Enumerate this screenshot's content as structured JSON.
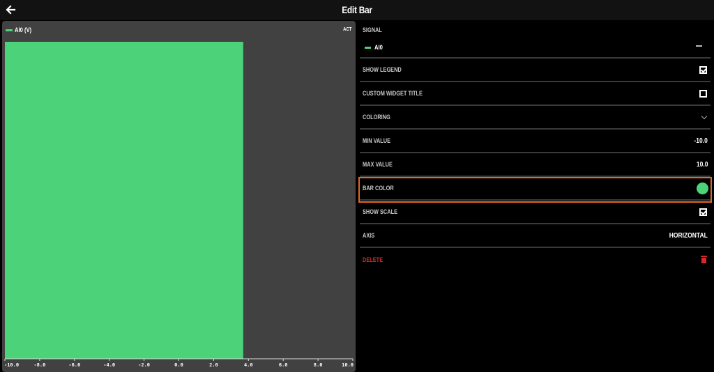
{
  "header": {
    "title": "Edit Bar",
    "back_icon": "arrow-left-icon"
  },
  "chart": {
    "legend_label": "AI0 (V)",
    "act_label": "ACT",
    "bar_color": "#4cd37a",
    "background": "#414141"
  },
  "chart_data": {
    "type": "bar",
    "orientation": "horizontal",
    "series": [
      {
        "name": "AI0 (V)",
        "values": [
          3.7
        ]
      }
    ],
    "xlim": [
      -10.0,
      10.0
    ],
    "xticks": [
      "-10.0",
      "-8.0",
      "-6.0",
      "-4.0",
      "-2.0",
      "0.0",
      "2.0",
      "4.0",
      "6.0",
      "8.0",
      "10.0"
    ],
    "xlabel": "",
    "ylabel": "",
    "title": "",
    "grid": false
  },
  "settings": {
    "signal_header": "SIGNAL",
    "signal_name": "AI0",
    "signal_color": "#4cd37a",
    "show_legend_label": "SHOW LEGEND",
    "show_legend_checked": true,
    "custom_title_label": "CUSTOM WIDGET TITLE",
    "custom_title_checked": false,
    "coloring_label": "COLORING",
    "min_value_label": "MIN VALUE",
    "min_value": "-10.0",
    "max_value_label": "MAX VALUE",
    "max_value": "10.0",
    "bar_color_label": "BAR COLOR",
    "bar_color": "#4cd37a",
    "show_scale_label": "SHOW SCALE",
    "show_scale_checked": true,
    "axis_label": "AXIS",
    "axis_value": "HORIZONTAL",
    "delete_label": "DELETE",
    "highlight_color": "#e4661f"
  }
}
